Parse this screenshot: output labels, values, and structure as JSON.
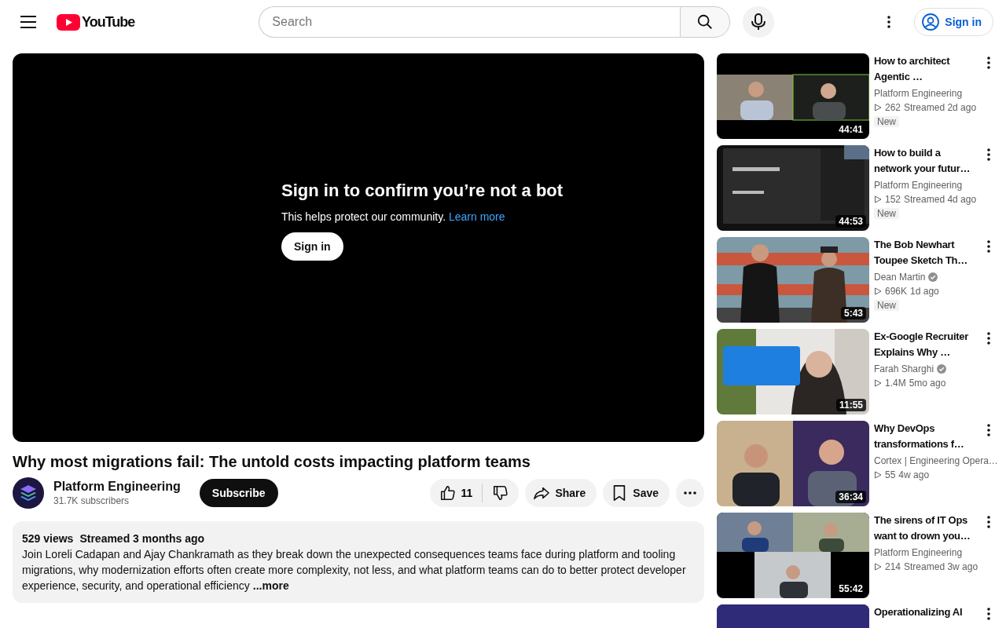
{
  "header": {
    "logo": "YouTube",
    "search": {
      "placeholder": "Search"
    },
    "sign_in": "Sign in"
  },
  "player": {
    "heading": "Sign in to confirm you’re not a bot",
    "message": "This helps protect our community.",
    "link": "Learn more",
    "button": "Sign in"
  },
  "video": {
    "title": "Why most migrations fail: The untold costs impacting platform teams",
    "channel": "Platform Engineering",
    "subscribers": "31.7K subscribers",
    "subscribe": "Subscribe",
    "likes": "11",
    "share": "Share",
    "save": "Save"
  },
  "description": {
    "views": "529 views",
    "date": "Streamed 3 months ago",
    "text": "Join Loreli Cadapan and Ajay Chankramath as they break down the unexpected consequences teams face during platform and tooling migrations, why modernization efforts often create more complexity, not less, and what platform teams can do to better protect developer experience, security, and operational efficiency",
    "more": "...more"
  },
  "related": [
    {
      "title": "How to architect Agentic …",
      "channel": "Platform Engineering",
      "verified": false,
      "views": "262",
      "age": "Streamed 2d ago",
      "badge": "New",
      "duration": "44:41"
    },
    {
      "title": "How to build a network your futur…",
      "channel": "Platform Engineering",
      "verified": false,
      "views": "152",
      "age": "Streamed 4d ago",
      "badge": "New",
      "duration": "44:53"
    },
    {
      "title": "The Bob Newhart Toupee Sketch Th…",
      "channel": "Dean Martin",
      "verified": true,
      "views": "696K",
      "age": "1d ago",
      "badge": "New",
      "duration": "5:43"
    },
    {
      "title": "Ex-Google Recruiter Explains Why …",
      "channel": "Farah Sharghi",
      "verified": true,
      "views": "1.4M",
      "age": "5mo ago",
      "duration": "11:55"
    },
    {
      "title": "Why DevOps transformations f…",
      "channel": "Cortex | Engineering Opera…",
      "verified": false,
      "views": "55",
      "age": "4w ago",
      "duration": "36:34"
    },
    {
      "title": "The sirens of IT Ops want to drown you…",
      "channel": "Platform Engineering",
      "verified": false,
      "views": "214",
      "age": "Streamed 3w ago",
      "duration": "55:42"
    },
    {
      "title": "Operationalizing AI"
    }
  ]
}
